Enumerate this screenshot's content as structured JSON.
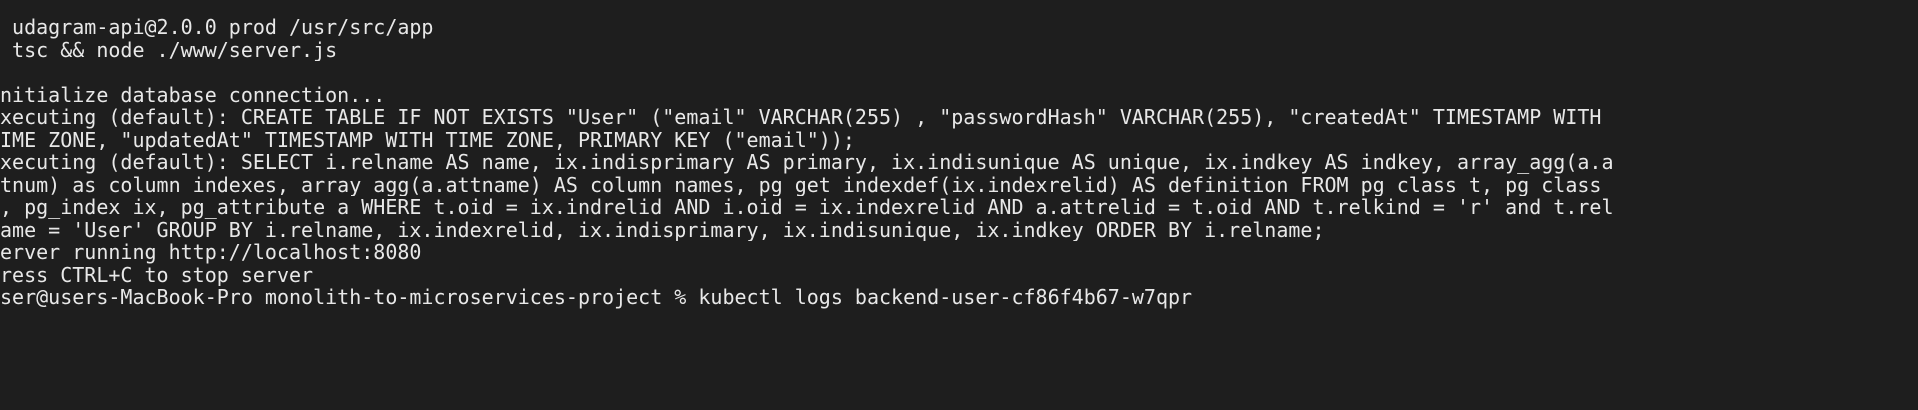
{
  "terminal": {
    "background": "#1e1e1e",
    "foreground": "#e8e8e8",
    "lines": [
      " udagram-api@2.0.0 prod /usr/src/app",
      " tsc && node ./www/server.js",
      "",
      "nitialize database connection...",
      "xecuting (default): CREATE TABLE IF NOT EXISTS \"User\" (\"email\" VARCHAR(255) , \"passwordHash\" VARCHAR(255), \"createdAt\" TIMESTAMP WITH",
      "IME ZONE, \"updatedAt\" TIMESTAMP WITH TIME ZONE, PRIMARY KEY (\"email\"));",
      "xecuting (default): SELECT i.relname AS name, ix.indisprimary AS primary, ix.indisunique AS unique, ix.indkey AS indkey, array_agg(a.a",
      "tnum) as column_indexes, array_agg(a.attname) AS column_names, pg_get_indexdef(ix.indexrelid) AS definition FROM pg_class t, pg_class",
      ", pg_index ix, pg_attribute a WHERE t.oid = ix.indrelid AND i.oid = ix.indexrelid AND a.attrelid = t.oid AND t.relkind = 'r' and t.rel",
      "ame = 'User' GROUP BY i.relname, ix.indexrelid, ix.indisprimary, ix.indisunique, ix.indkey ORDER BY i.relname;",
      "erver running http://localhost:8080",
      "ress CTRL+C to stop server",
      "ser@users-MacBook-Pro monolith-to-microservices-project % kubectl logs backend-user-cf86f4b67-w7qpr"
    ]
  }
}
